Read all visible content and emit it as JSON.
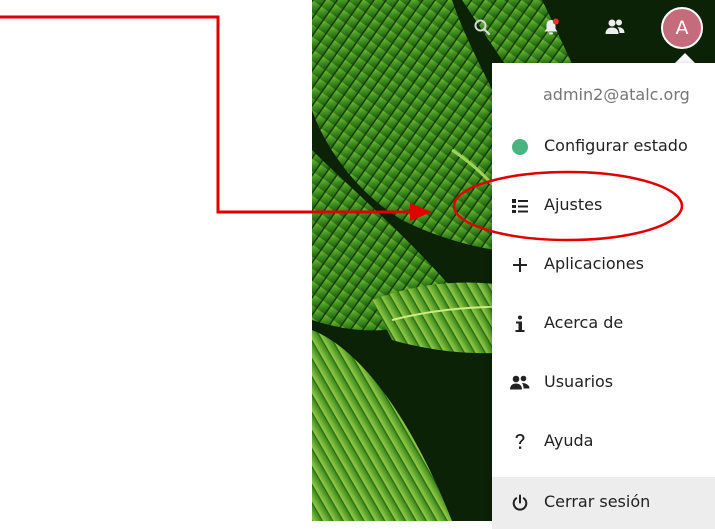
{
  "topbar": {
    "search_icon": "search-icon",
    "notifications_icon": "bell-icon",
    "contacts_icon": "contacts-icon",
    "avatar_initial": "A"
  },
  "menu": {
    "user_email": "admin2@atalc.org",
    "items": [
      {
        "label": "Configurar estado",
        "icon": "status-dot-icon"
      },
      {
        "label": "Ajustes",
        "icon": "settings-list-icon"
      },
      {
        "label": "Aplicaciones",
        "icon": "plus-icon"
      },
      {
        "label": "Acerca de",
        "icon": "info-icon"
      },
      {
        "label": "Usuarios",
        "icon": "users-icon"
      },
      {
        "label": "Ayuda",
        "icon": "help-icon"
      },
      {
        "label": "Cerrar sesión",
        "icon": "power-icon"
      }
    ]
  },
  "colors": {
    "status_online": "#49b382",
    "avatar": "#c46b7c",
    "annotation": "#e00000"
  }
}
